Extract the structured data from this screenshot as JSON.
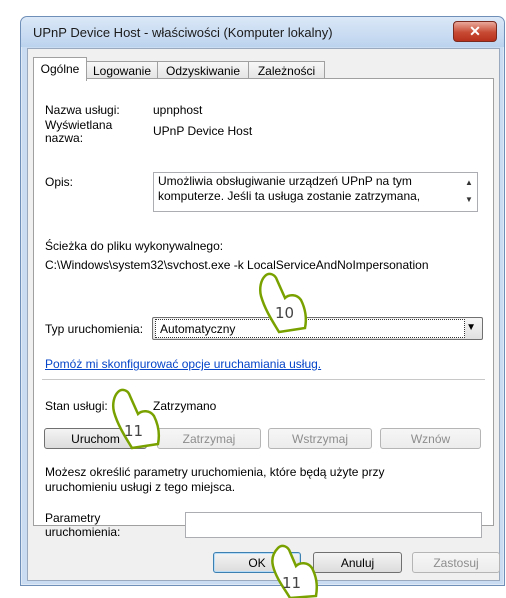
{
  "window": {
    "title": "UPnP Device Host   - właściwości (Komputer lokalny)",
    "close_glyph": "✕"
  },
  "tabs": [
    {
      "label": "Ogólne",
      "active": true
    },
    {
      "label": "Logowanie",
      "active": false
    },
    {
      "label": "Odzyskiwanie",
      "active": false
    },
    {
      "label": "Zależności",
      "active": false
    }
  ],
  "general": {
    "service_name_label": "Nazwa usługi:",
    "service_name_value": "upnphost",
    "display_name_label_1": "Wyświetlana",
    "display_name_label_2": "nazwa:",
    "display_name_value": "UPnP Device Host",
    "description_label": "Opis:",
    "description_line_1": "Umożliwia obsługiwanie urządzeń UPnP na tym",
    "description_line_2": "komputerze. Jeśli ta usługa zostanie zatrzymana,",
    "path_label": "Ścieżka do pliku wykonywalnego:",
    "path_value": "C:\\Windows\\system32\\svchost.exe -k LocalServiceAndNoImpersonation",
    "startup_type_label": "Typ uruchomienia:",
    "startup_type_value": "Automatyczny",
    "help_link": "Pomóż mi skonfigurować opcje uruchamiania usług.",
    "status_label": "Stan usługi:",
    "status_value": "Zatrzymano",
    "start_button": "Uruchom",
    "stop_button": "Zatrzymaj",
    "pause_button": "Wstrzymaj",
    "resume_button": "Wznów",
    "params_hint_line_1": "Możesz określić parametry uruchomienia, które będą użyte przy",
    "params_hint_line_2": "uruchomieniu usługi z tego miejsca.",
    "params_label_1": "Parametry",
    "params_label_2": "uruchomienia:",
    "params_value": ""
  },
  "footer": {
    "ok_button": "OK",
    "cancel_button": "Anuluj",
    "apply_button": "Zastosuj"
  },
  "callouts": [
    "10",
    "11",
    "11"
  ],
  "colors": {
    "link": "#0645c8",
    "callout_stroke": "#79a200",
    "close_button": "#c74a33"
  },
  "icons": {
    "description_scroll_up": "▲",
    "description_scroll_down": "▼",
    "dropdown_arrow": "▼"
  }
}
